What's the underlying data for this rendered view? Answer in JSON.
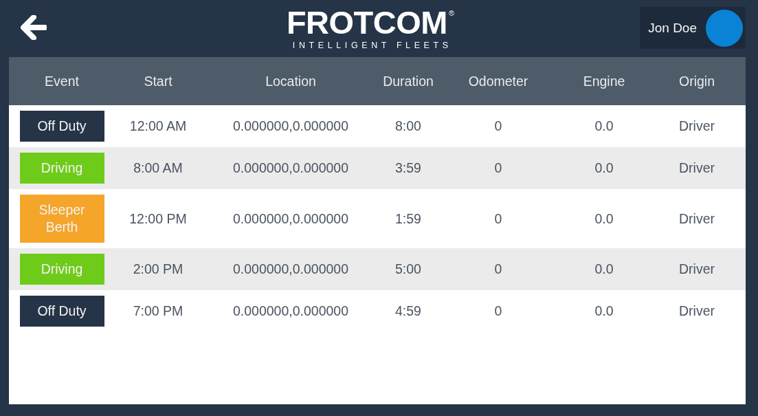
{
  "header": {
    "logo": {
      "wordmark": "FROTCOM",
      "registered_mark": "®",
      "tagline": "INTELLIGENT FLEETS"
    },
    "user": {
      "name": "Jon Doe"
    }
  },
  "table": {
    "columns": [
      "Event",
      "Start",
      "Location",
      "Duration",
      "Odometer",
      "Engine",
      "Origin"
    ],
    "rows": [
      {
        "event": "Off Duty",
        "color": "#253447",
        "start": "12:00 AM",
        "location": "0.000000,0.000000",
        "duration": "8:00",
        "odometer": "0",
        "engine": "0.0",
        "origin": "Driver"
      },
      {
        "event": "Driving",
        "color": "#6fcb1a",
        "start": "8:00 AM",
        "location": "0.000000,0.000000",
        "duration": "3:59",
        "odometer": "0",
        "engine": "0.0",
        "origin": "Driver"
      },
      {
        "event": "Sleeper Berth",
        "color": "#f5a52a",
        "start": "12:00 PM",
        "location": "0.000000,0.000000",
        "duration": "1:59",
        "odometer": "0",
        "engine": "0.0",
        "origin": "Driver"
      },
      {
        "event": "Driving",
        "color": "#6fcb1a",
        "start": "2:00 PM",
        "location": "0.000000,0.000000",
        "duration": "5:00",
        "odometer": "0",
        "engine": "0.0",
        "origin": "Driver"
      },
      {
        "event": "Off Duty",
        "color": "#253447",
        "start": "7:00 PM",
        "location": "0.000000,0.000000",
        "duration": "4:59",
        "odometer": "0",
        "engine": "0.0",
        "origin": "Driver"
      }
    ]
  }
}
